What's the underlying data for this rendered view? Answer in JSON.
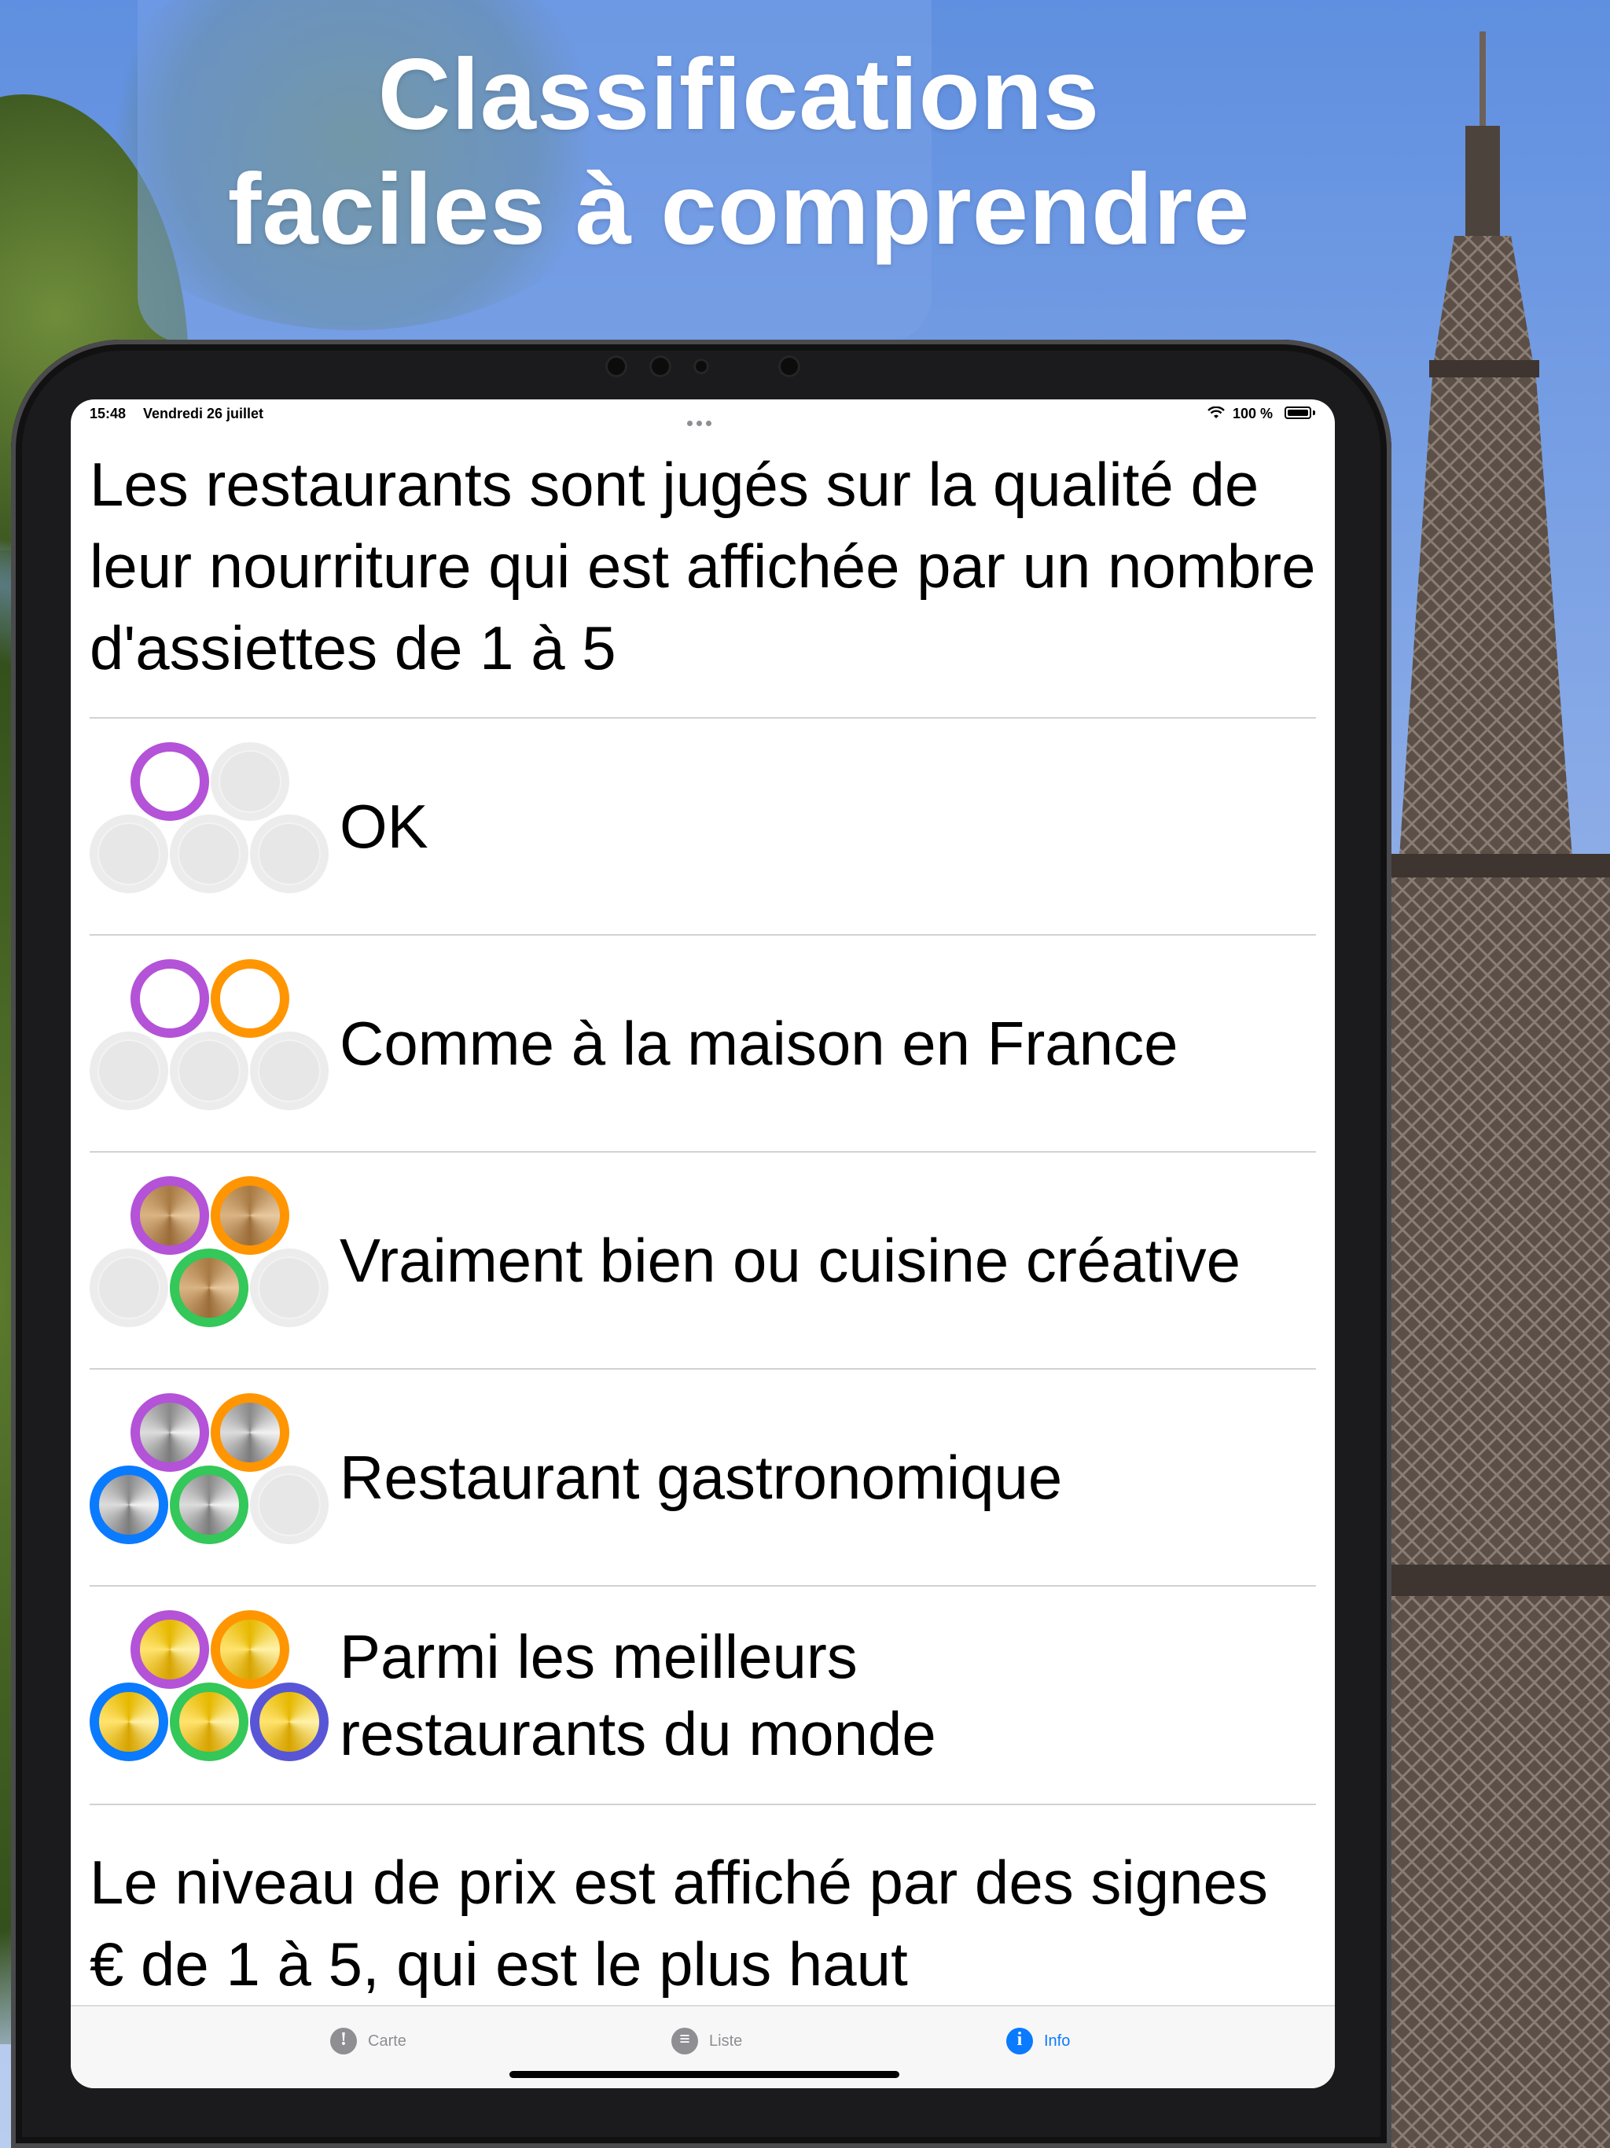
{
  "headline": {
    "line1": "Classifications",
    "line2": "faciles à comprendre"
  },
  "status_bar": {
    "time": "15:48",
    "date": "Vendredi 26 juillet",
    "battery": "100 %"
  },
  "intro_text": "Les restaurants sont jugés sur la qualité de leur nourriture qui est affichée par un nombre d'assiettes de 1 à 5",
  "ratings": [
    {
      "label": "OK",
      "plates": 1,
      "finish": "ring"
    },
    {
      "label": "Comme à la maison en France",
      "plates": 2,
      "finish": "ring"
    },
    {
      "label": "Vraiment bien ou cuisine créative",
      "plates": 3,
      "finish": "bronze"
    },
    {
      "label": "Restaurant gastronomique",
      "plates": 4,
      "finish": "silver"
    },
    {
      "label": "Parmi les meilleurs restaurants du monde",
      "plates": 5,
      "finish": "gold"
    }
  ],
  "plate_colors": [
    "#b452d8",
    "#ff9500",
    "#34c759",
    "#0a7aff",
    "#5856d6"
  ],
  "price_text": "Le niveau de prix est affiché par des signes € de 1 à 5, qui est le plus haut",
  "tabs": [
    {
      "label": "Carte",
      "icon": "map-pin-icon",
      "active": false
    },
    {
      "label": "Liste",
      "icon": "list-icon",
      "active": false
    },
    {
      "label": "Info",
      "icon": "info-icon",
      "active": true
    }
  ],
  "accent_color": "#0a7aff"
}
